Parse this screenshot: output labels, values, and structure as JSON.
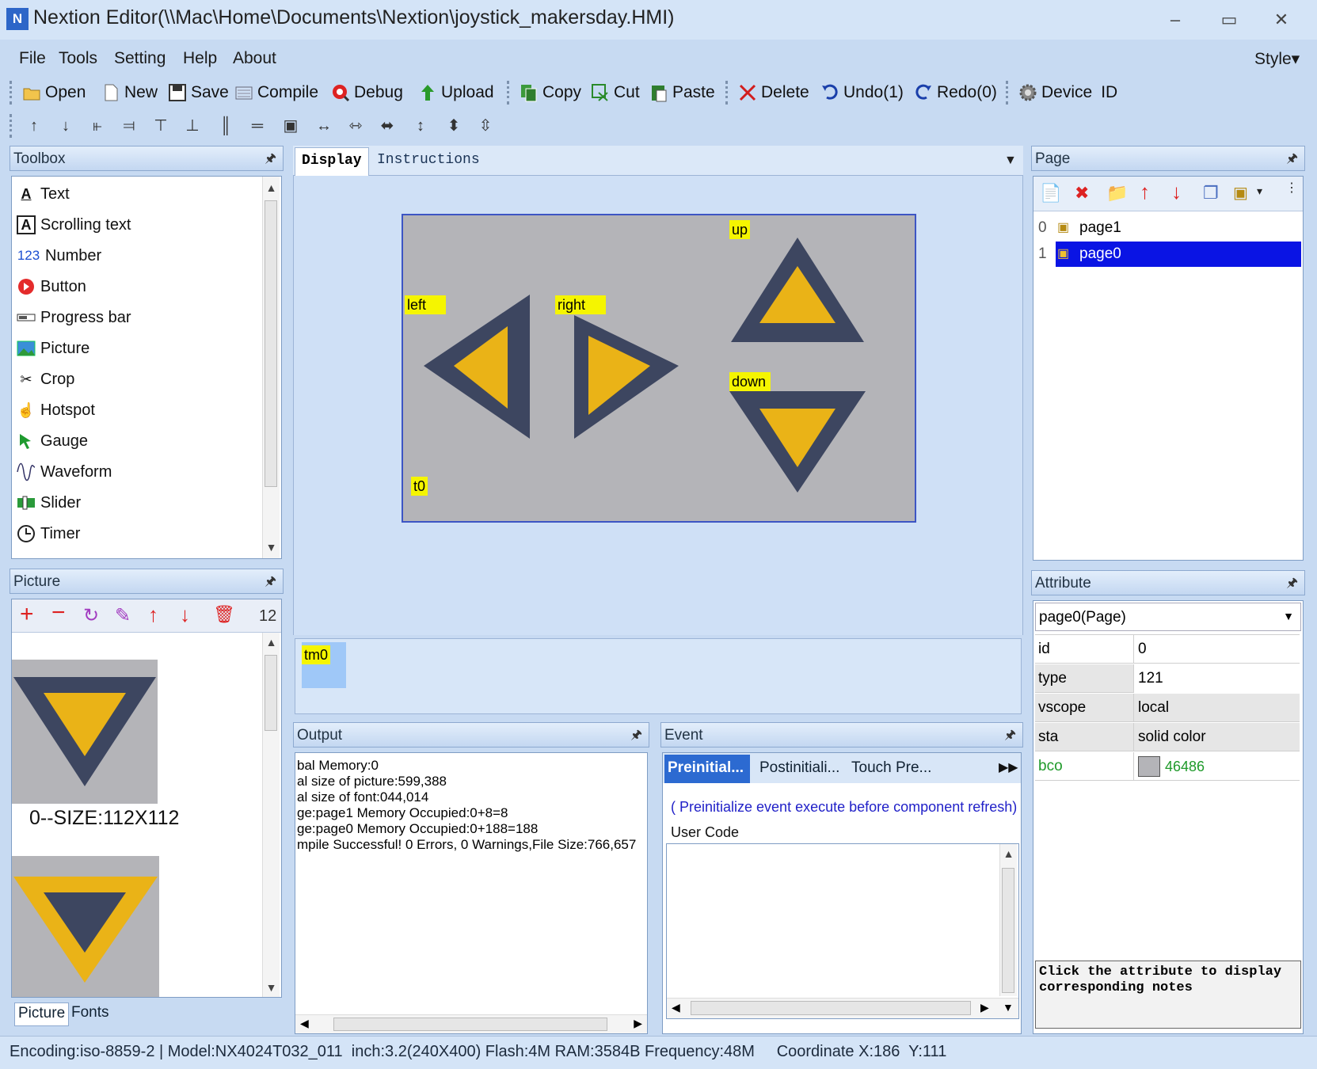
{
  "window": {
    "title": "Nextion Editor(\\\\Mac\\Home\\Documents\\Nextion\\joystick_makersday.HMI)",
    "icon": "N"
  },
  "menu": {
    "file": "File",
    "tools": "Tools",
    "setting": "Setting",
    "help": "Help",
    "about": "About",
    "style": "Style▾"
  },
  "toolbar": {
    "open": "Open",
    "new": "New",
    "save": "Save",
    "compile": "Compile",
    "debug": "Debug",
    "upload": "Upload",
    "copy": "Copy",
    "cut": "Cut",
    "paste": "Paste",
    "delete": "Delete",
    "undo": "Undo(1)",
    "redo": "Redo(0)",
    "device": "Device",
    "id": "ID"
  },
  "toolbox": {
    "title": "Toolbox",
    "items": [
      "Text",
      "Scrolling text",
      "Number",
      "Button",
      "Progress bar",
      "Picture",
      "Crop",
      "Hotspot",
      "Gauge",
      "Waveform",
      "Slider",
      "Timer"
    ]
  },
  "picture_panel": {
    "title": "Picture",
    "count": "12",
    "caption0": "0--SIZE:112X112",
    "tab_picture": "Picture",
    "tab_fonts": "Fonts"
  },
  "display": {
    "tab_display": "Display",
    "tab_instructions": "Instructions"
  },
  "canvas": {
    "labels": {
      "up": "up",
      "left": "left",
      "right": "right",
      "down": "down",
      "t0": "t0"
    },
    "bg_color": "#b4b4b8",
    "arrow_dark": "#3d4660",
    "arrow_fill": "#eab317"
  },
  "timer_area": {
    "tm0": "tm0"
  },
  "output": {
    "title": "Output",
    "lines": [
      "bal Memory:0",
      "al size of picture:599,388",
      "al size of font:044,014",
      "ge:page1 Memory Occupied:0+8=8",
      "ge:page0 Memory Occupied:0+188=188",
      "mpile Successful! 0 Errors, 0 Warnings,File Size:766,657"
    ]
  },
  "event": {
    "title": "Event",
    "tab1": "Preinitial...",
    "tab2": "Postinitiali...",
    "tab3": "Touch Pre...",
    "note": "( Preinitialize event execute before component refresh)",
    "usercode": "User Code"
  },
  "page_panel": {
    "title": "Page",
    "pages": [
      {
        "num": "0",
        "name": "page1"
      },
      {
        "num": "1",
        "name": "page0"
      }
    ]
  },
  "attribute": {
    "title": "Attribute",
    "selected": "page0(Page)",
    "rows": [
      {
        "k": "id",
        "v": "0"
      },
      {
        "k": "type",
        "v": "121"
      },
      {
        "k": "vscope",
        "v": "local"
      },
      {
        "k": "sta",
        "v": "solid color"
      },
      {
        "k": "bco",
        "v": "46486"
      }
    ],
    "notes": "Click the attribute to display corresponding notes"
  },
  "status": {
    "text": "Encoding:iso-8859-2 | Model:NX4024T032_011  inch:3.2(240X400) Flash:4M RAM:3584B Frequency:48M     Coordinate X:186  Y:111"
  }
}
